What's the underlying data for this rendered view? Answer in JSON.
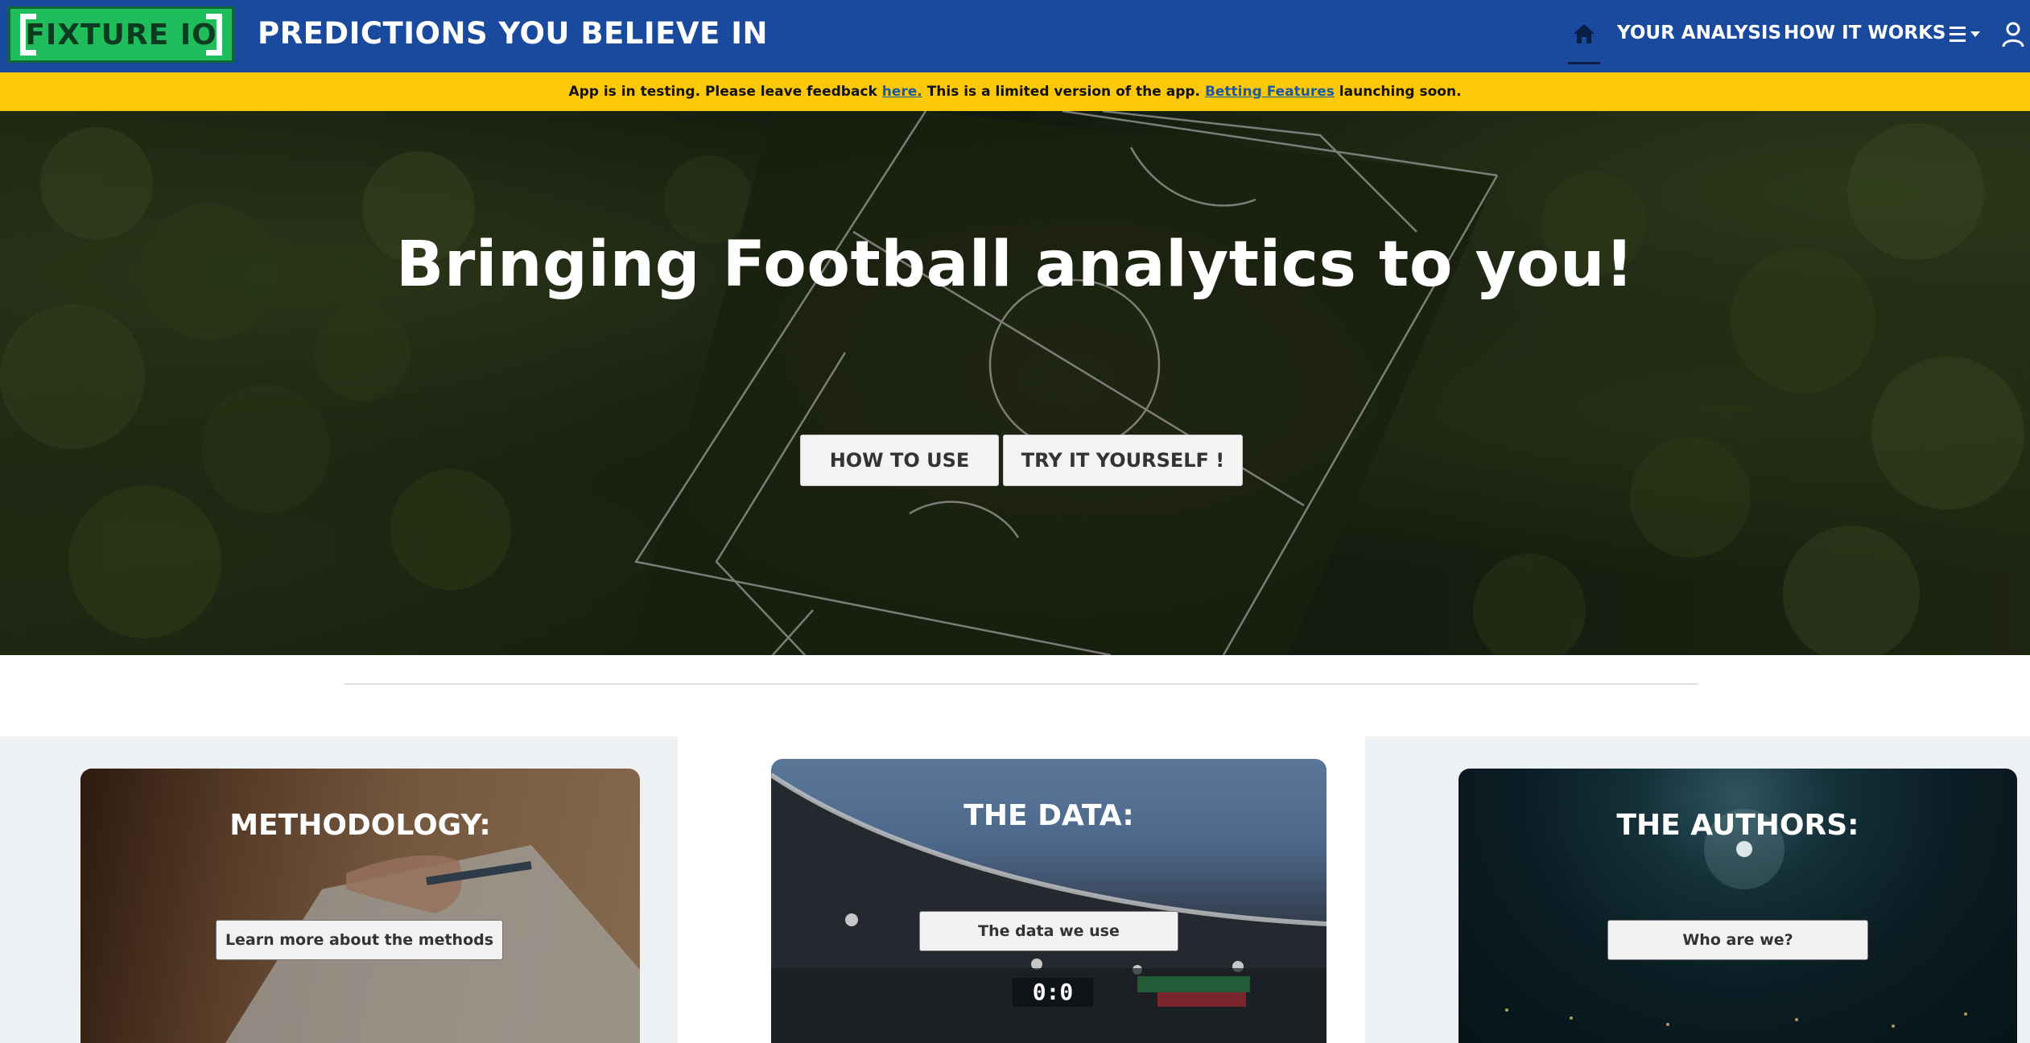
{
  "brand": {
    "logo_text": "FIXTURE IO",
    "title": "PREDICTIONS YOU BELIEVE IN"
  },
  "nav": {
    "home_icon": "home-icon",
    "links": [
      "YOUR ANALYSIS",
      "HOW IT WORKS"
    ],
    "menu_icon": "hamburger-dropdown-icon",
    "user_icon": "user-icon"
  },
  "banner": {
    "text_1": "App is in testing. Please leave feedback ",
    "link_1": "here.",
    "text_2": " This is a limited version of the app. ",
    "link_2": "Betting Features",
    "text_3": " launching soon."
  },
  "hero": {
    "title": "Bringing Football analytics to you!",
    "btn_how_to_use": "HOW TO USE",
    "btn_try": "TRY IT YOURSELF !"
  },
  "cards": [
    {
      "title": "METHODOLOGY:",
      "button": "Learn more about the methods"
    },
    {
      "title": "THE DATA:",
      "button": "The data we use",
      "scoreboard": "0:0"
    },
    {
      "title": "THE AUTHORS:",
      "button": "Who are we?"
    }
  ],
  "colors": {
    "navbar": "#1a4a9e",
    "banner": "#fcc908",
    "logo_green": "#1fbd5c"
  }
}
